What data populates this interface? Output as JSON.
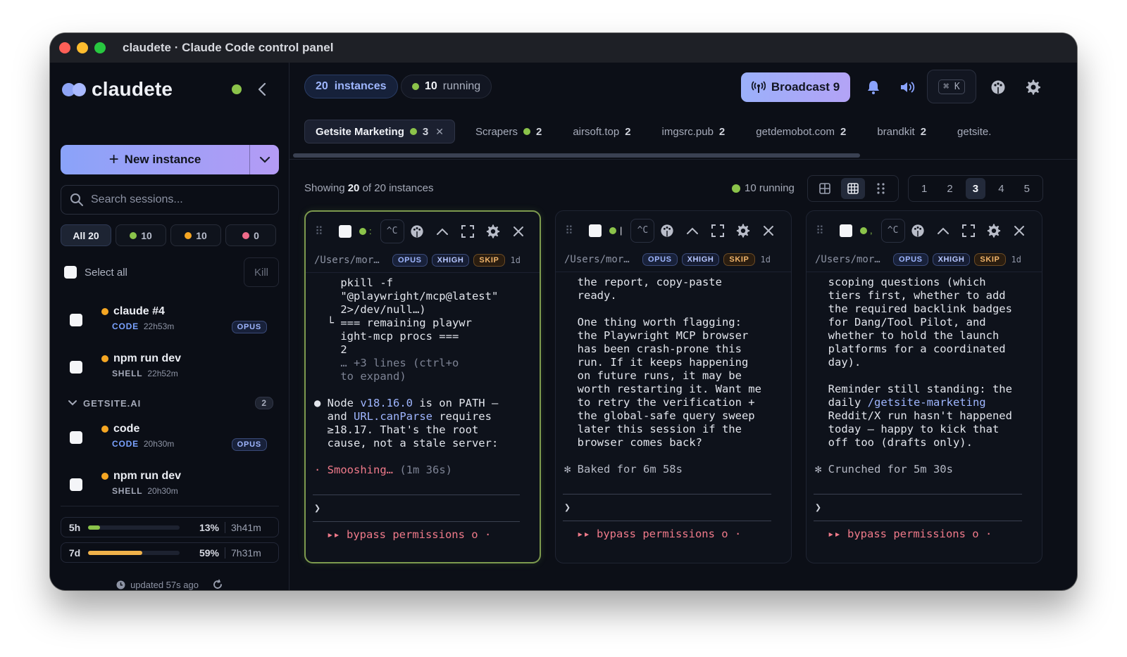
{
  "window": {
    "title": "claudete · Claude Code control panel"
  },
  "sidebar": {
    "brand": "claudete",
    "new_instance_label": "New instance",
    "search_placeholder": "Search sessions...",
    "filters": [
      {
        "label": "All 20"
      },
      {
        "label": "10",
        "color": "#8bc34a"
      },
      {
        "label": "10",
        "color": "#f5a623"
      },
      {
        "label": "0",
        "color": "#f06b8a"
      }
    ],
    "select_all_label": "Select all",
    "kill_label": "Kill",
    "sessions": [
      {
        "name": "claude #4",
        "kind": "CODE",
        "time": "22h53m",
        "badge": "OPUS"
      },
      {
        "name": "npm run dev",
        "kind": "SHELL",
        "time": "22h52m"
      },
      {
        "name": "code",
        "kind": "CODE",
        "time": "20h30m",
        "badge": "OPUS"
      },
      {
        "name": "npm run dev",
        "kind": "SHELL",
        "time": "20h30m"
      }
    ],
    "group": {
      "name": "GETSITE.AI",
      "count": "2"
    },
    "usage": [
      {
        "label": "5h",
        "pct": "13%",
        "fraction": 0.13,
        "duration": "3h41m",
        "color": "#8bc34a"
      },
      {
        "label": "7d",
        "pct": "59%",
        "fraction": 0.59,
        "duration": "7h31m",
        "color": "#f0b14a"
      }
    ],
    "updated": "updated 57s ago"
  },
  "header": {
    "instances_label": "20  instances",
    "running_count": "10",
    "running_label": "running",
    "broadcast_label": "Broadcast 9",
    "shortcut": "⌘ K"
  },
  "tabs": [
    {
      "label": "Getsite Marketing",
      "count": "3",
      "active": true
    },
    {
      "label": "Scrapers",
      "count": "2"
    },
    {
      "label": "airsoft.top",
      "count": "2"
    },
    {
      "label": "imgsrc.pub",
      "count": "2"
    },
    {
      "label": "getdemobot.com",
      "count": "2"
    },
    {
      "label": "brandkit",
      "count": "2"
    },
    {
      "label": "getsite."
    }
  ],
  "toolbar": {
    "showing_prefix": "Showing ",
    "showing_count": "20",
    "showing_suffix": " of 20 instances",
    "running_label": "10 running",
    "pages": [
      "1",
      "2",
      "3",
      "4",
      "5"
    ],
    "current_page": "3"
  },
  "cards": [
    {
      "path": "/Users/mor…",
      "badges": [
        "OPUS",
        "XHIGH",
        "SKIP"
      ],
      "age": "1d",
      "ctrl": "^C",
      "prompt": "❯",
      "bypass": "▸▸ bypass permissions o ·"
    },
    {
      "path": "/Users/mor…",
      "badges": [
        "OPUS",
        "XHIGH",
        "SKIP"
      ],
      "age": "1d",
      "ctrl": "^C",
      "prompt": "❯",
      "bypass": "▸▸ bypass permissions o ·"
    },
    {
      "path": "/Users/mor…",
      "badges": [
        "OPUS",
        "XHIGH",
        "SKIP"
      ],
      "age": "1d",
      "ctrl": "^C",
      "prompt": "❯",
      "bypass": "▸▸ bypass permissions o ·"
    }
  ],
  "terminals": {
    "t1": {
      "l1": "    pkill -f",
      "l2": "    \"@playwright/mcp@latest\"",
      "l3": "    2>/dev/null…)",
      "l4": "  └ === remaining playwr",
      "l5": "    ight-mcp procs ===",
      "l6": "    2",
      "l7": "    … +3 lines (ctrl+o",
      "l8": "    to expand)",
      "l9a": "● Node ",
      "l9b": "v18.16.0",
      "l9c": " is on PATH —",
      "l10a": "  and ",
      "l10b": "URL.canParse",
      "l10c": " requires",
      "l11": "  ≥18.17. That's the root",
      "l12": "  cause, not a stale server:",
      "l13a": "· ",
      "l13b": "Smooshing…",
      "l13c": " (1m 36s)"
    },
    "t2": {
      "l1": "  the report, copy-paste",
      "l2": "  ready.",
      "l3": "  One thing worth flagging:",
      "l4": "  the Playwright MCP browser",
      "l5": "  has been crash-prone this",
      "l6": "  run. If it keeps happening",
      "l7": "  on future runs, it may be",
      "l8": "  worth restarting it. Want me",
      "l9": "  to retry the verification +",
      "l10": "  the global-safe query sweep",
      "l11": "  later this session if the",
      "l12": "  browser comes back?",
      "l13": "✻ Baked for 6m 58s"
    },
    "t3": {
      "l1": "  scoping questions (which",
      "l2": "  tiers first, whether to add",
      "l3": "  the required backlink badges",
      "l4": "  for Dang/Tool Pilot, and",
      "l5": "  whether to hold the launch",
      "l6": "  platforms for a coordinated",
      "l7": "  day).",
      "l8": "  Reminder still standing: the",
      "l9a": "  daily ",
      "l9b": "/getsite-marketing",
      "l10": "  Reddit/X run hasn't happened",
      "l11": "  today — happy to kick that",
      "l12": "  off too (drafts only).",
      "l13": "✻ Crunched for 5m 30s"
    }
  }
}
